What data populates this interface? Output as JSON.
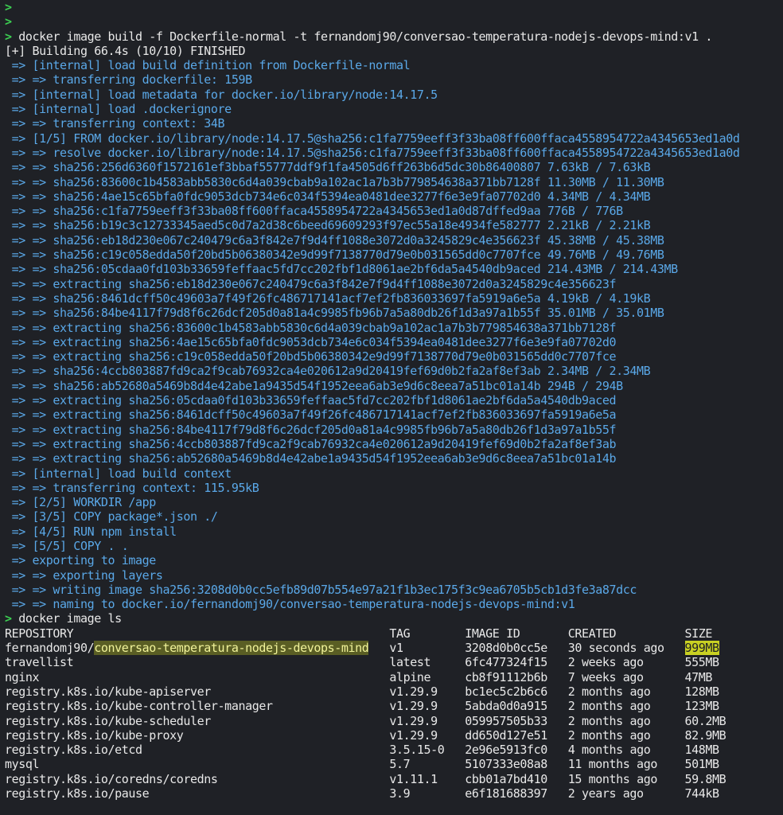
{
  "colors": {
    "background": "#1f2126",
    "prompt": "#3ccf52",
    "build_output": "#5aa8e8",
    "text": "#e8e8e8",
    "highlight": "#c8d022"
  },
  "prompt_symbol": ">",
  "lines": [
    {
      "type": "prompt",
      "text": ""
    },
    {
      "type": "prompt",
      "text": ""
    },
    {
      "type": "prompt",
      "text": "docker image build -f Dockerfile-normal -t fernandomj90/conversao-temperatura-nodejs-devops-mind:v1 ."
    },
    {
      "type": "white",
      "text": "[+] Building 66.4s (10/10) FINISHED"
    },
    {
      "type": "blue",
      "text": " => [internal] load build definition from Dockerfile-normal"
    },
    {
      "type": "blue",
      "text": " => => transferring dockerfile: 159B"
    },
    {
      "type": "blue",
      "text": " => [internal] load metadata for docker.io/library/node:14.17.5"
    },
    {
      "type": "blue",
      "text": " => [internal] load .dockerignore"
    },
    {
      "type": "blue",
      "text": " => => transferring context: 34B"
    },
    {
      "type": "blue",
      "text": " => [1/5] FROM docker.io/library/node:14.17.5@sha256:c1fa7759eeff3f33ba08ff600ffaca4558954722a4345653ed1a0d"
    },
    {
      "type": "blue",
      "text": " => => resolve docker.io/library/node:14.17.5@sha256:c1fa7759eeff3f33ba08ff600ffaca4558954722a4345653ed1a0d"
    },
    {
      "type": "blue",
      "text": " => => sha256:256d6360f1572161ef3bbaf55777ddf9f1fa4505d6ff263b6d5dc30b86400807 7.63kB / 7.63kB"
    },
    {
      "type": "blue",
      "text": " => => sha256:83600c1b4583abb5830c6d4a039cbab9a102ac1a7b3b779854638a371bb7128f 11.30MB / 11.30MB"
    },
    {
      "type": "blue",
      "text": " => => sha256:4ae15c65bfa0fdc9053dcb734e6c034f5394ea0481dee3277f6e3e9fa07702d0 4.34MB / 4.34MB"
    },
    {
      "type": "blue",
      "text": " => => sha256:c1fa7759eeff3f33ba08ff600ffaca4558954722a4345653ed1a0d87dffed9aa 776B / 776B"
    },
    {
      "type": "blue",
      "text": " => => sha256:b19c3c12733345aed5c0d7a2d38c6beed69609293f97ec55a18e4934fe582777 2.21kB / 2.21kB"
    },
    {
      "type": "blue",
      "text": " => => sha256:eb18d230e067c240479c6a3f842e7f9d4ff1088e3072d0a3245829c4e356623f 45.38MB / 45.38MB"
    },
    {
      "type": "blue",
      "text": " => => sha256:c19c058edda50f20bd5b06380342e9d99f7138770d79e0b031565dd0c7707fce 49.76MB / 49.76MB"
    },
    {
      "type": "blue",
      "text": " => => sha256:05cdaa0fd103b33659feffaac5fd7cc202fbf1d8061ae2bf6da5a4540db9aced 214.43MB / 214.43MB"
    },
    {
      "type": "blue",
      "text": " => => extracting sha256:eb18d230e067c240479c6a3f842e7f9d4ff1088e3072d0a3245829c4e356623f"
    },
    {
      "type": "blue",
      "text": " => => sha256:8461dcff50c49603a7f49f26fc486717141acf7ef2fb836033697fa5919a6e5a 4.19kB / 4.19kB"
    },
    {
      "type": "blue",
      "text": " => => sha256:84be4117f79d8f6c26dcf205d0a81a4c9985fb96b7a5a80db26f1d3a97a1b55f 35.01MB / 35.01MB"
    },
    {
      "type": "blue",
      "text": " => => extracting sha256:83600c1b4583abb5830c6d4a039cbab9a102ac1a7b3b779854638a371bb7128f"
    },
    {
      "type": "blue",
      "text": " => => extracting sha256:4ae15c65bfa0fdc9053dcb734e6c034f5394ea0481dee3277f6e3e9fa07702d0"
    },
    {
      "type": "blue",
      "text": " => => extracting sha256:c19c058edda50f20bd5b06380342e9d99f7138770d79e0b031565dd0c7707fce"
    },
    {
      "type": "blue",
      "text": " => => sha256:4ccb803887fd9ca2f9cab76932ca4e020612a9d20419fef69d0b2fa2af8ef3ab 2.34MB / 2.34MB"
    },
    {
      "type": "blue",
      "text": " => => sha256:ab52680a5469b8d4e42abe1a9435d54f1952eea6ab3e9d6c8eea7a51bc01a14b 294B / 294B"
    },
    {
      "type": "blue",
      "text": " => => extracting sha256:05cdaa0fd103b33659feffaac5fd7cc202fbf1d8061ae2bf6da5a4540db9aced"
    },
    {
      "type": "blue",
      "text": " => => extracting sha256:8461dcff50c49603a7f49f26fc486717141acf7ef2fb836033697fa5919a6e5a"
    },
    {
      "type": "blue",
      "text": " => => extracting sha256:84be4117f79d8f6c26dcf205d0a81a4c9985fb96b7a5a80db26f1d3a97a1b55f"
    },
    {
      "type": "blue",
      "text": " => => extracting sha256:4ccb803887fd9ca2f9cab76932ca4e020612a9d20419fef69d0b2fa2af8ef3ab"
    },
    {
      "type": "blue",
      "text": " => => extracting sha256:ab52680a5469b8d4e42abe1a9435d54f1952eea6ab3e9d6c8eea7a51bc01a14b"
    },
    {
      "type": "blue",
      "text": " => [internal] load build context"
    },
    {
      "type": "blue",
      "text": " => => transferring context: 115.95kB"
    },
    {
      "type": "blue",
      "text": " => [2/5] WORKDIR /app"
    },
    {
      "type": "blue",
      "text": " => [3/5] COPY package*.json ./"
    },
    {
      "type": "blue",
      "text": " => [4/5] RUN npm install"
    },
    {
      "type": "blue",
      "text": " => [5/5] COPY . ."
    },
    {
      "type": "blue",
      "text": " => exporting to image"
    },
    {
      "type": "blue",
      "text": " => => exporting layers"
    },
    {
      "type": "blue",
      "text": " => => writing image sha256:3208d0b0cc5efb89d07b554e97a21f1b3ec175f3c9ea6705b5cb1d3fe3a87dcc"
    },
    {
      "type": "blue",
      "text": " => => naming to docker.io/fernandomj90/conversao-temperatura-nodejs-devops-mind:v1"
    },
    {
      "type": "prompt",
      "text": "docker image ls"
    }
  ],
  "image_table": {
    "headers": [
      "REPOSITORY",
      "TAG",
      "IMAGE ID",
      "CREATED",
      "SIZE"
    ],
    "rows": [
      {
        "repo_prefix": "fernandomj90/",
        "repo_highlight": "conversao-temperatura-nodejs-devops-mind",
        "tag": "v1",
        "id": "3208d0b0cc5e",
        "created": "30 seconds ago",
        "size": "999MB",
        "highlight": true
      },
      {
        "repo_prefix": "travellist",
        "repo_highlight": "",
        "tag": "latest",
        "id": "6fc477324f15",
        "created": "2 weeks ago",
        "size": "555MB"
      },
      {
        "repo_prefix": "nginx",
        "repo_highlight": "",
        "tag": "alpine",
        "id": "cb8f91112b6b",
        "created": "7 weeks ago",
        "size": "47MB"
      },
      {
        "repo_prefix": "registry.k8s.io/kube-apiserver",
        "repo_highlight": "",
        "tag": "v1.29.9",
        "id": "bc1ec5c2b6c6",
        "created": "2 months ago",
        "size": "128MB"
      },
      {
        "repo_prefix": "registry.k8s.io/kube-controller-manager",
        "repo_highlight": "",
        "tag": "v1.29.9",
        "id": "5abda0d0a915",
        "created": "2 months ago",
        "size": "123MB"
      },
      {
        "repo_prefix": "registry.k8s.io/kube-scheduler",
        "repo_highlight": "",
        "tag": "v1.29.9",
        "id": "059957505b33",
        "created": "2 months ago",
        "size": "60.2MB"
      },
      {
        "repo_prefix": "registry.k8s.io/kube-proxy",
        "repo_highlight": "",
        "tag": "v1.29.9",
        "id": "dd650d127e51",
        "created": "2 months ago",
        "size": "82.9MB"
      },
      {
        "repo_prefix": "registry.k8s.io/etcd",
        "repo_highlight": "",
        "tag": "3.5.15-0",
        "id": "2e96e5913fc0",
        "created": "4 months ago",
        "size": "148MB"
      },
      {
        "repo_prefix": "mysql",
        "repo_highlight": "",
        "tag": "5.7",
        "id": "5107333e08a8",
        "created": "11 months ago",
        "size": "501MB"
      },
      {
        "repo_prefix": "registry.k8s.io/coredns/coredns",
        "repo_highlight": "",
        "tag": "v1.11.1",
        "id": "cbb01a7bd410",
        "created": "15 months ago",
        "size": "59.8MB"
      },
      {
        "repo_prefix": "registry.k8s.io/pause",
        "repo_highlight": "",
        "tag": "3.9",
        "id": "e6f181688397",
        "created": "2 years ago",
        "size": "744kB"
      }
    ]
  }
}
